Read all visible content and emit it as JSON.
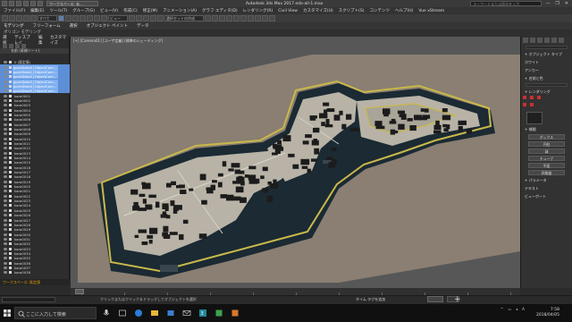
{
  "window": {
    "title": "Autodesk 3ds Max 2017     edo-all-1.max",
    "workspace": "ワークスペース: 未…",
    "search_placeholder": "キーワードまたは語句を入力",
    "controls": [
      "—",
      "❐",
      "✕"
    ]
  },
  "menubar": [
    "ファイル(F)",
    "編集(E)",
    "ツール(T)",
    "グループ(G)",
    "ビュー(V)",
    "作成(C)",
    "修正(M)",
    "アニメーション(A)",
    "グラフ エディタ(D)",
    "レンダリング(R)",
    "Civil View",
    "カスタマイズ(U)",
    "スクリプト(S)",
    "コンテンツ",
    "ヘルプ(H)",
    "Vue xStream"
  ],
  "toolbar": {
    "selection_filter": "すべて",
    "view_dropdown": "ビュー",
    "selection_set": "選択セットの作成"
  },
  "ribbon": {
    "tabs": [
      "モデリング",
      "フリーフォーム",
      "選択",
      "オブジェクト ペイント",
      "データ"
    ],
    "sub_label": "ポリゴン モデリング"
  },
  "explorer": {
    "tabs": [
      "選択",
      "ディスプレイ",
      "編集",
      "カスタマイズ"
    ],
    "column_header": "名前 (昇順ソート)",
    "root": "0 (既定値)",
    "selected_items": [
      "goreiData0 [ObjectCom…",
      "goreiData1 [ObjectCom…",
      "goreiData2 [ObjectCom…",
      "goreiData3 [ObjectCom…",
      "goreiData4 [ObjectCom…",
      "goreiData5 [ObjectCom…"
    ],
    "items": [
      "kara0001",
      "kara0002",
      "kara0003",
      "kara0004",
      "kara0005",
      "kara0006",
      "kara0007",
      "kara0008",
      "kara0009",
      "kara0010",
      "kara0011",
      "kara0012",
      "kara0013",
      "kara0014",
      "kara0015",
      "kara0016",
      "kara0017",
      "kara0018",
      "kara0019",
      "kara0020",
      "kara0021",
      "kara0022",
      "kara0023",
      "kara0024",
      "kara0025",
      "kara0026",
      "kara0027",
      "kara0028",
      "kara0029",
      "kara0030",
      "kara0031",
      "kara0032",
      "kara0033",
      "kara0034",
      "kara0035",
      "kara0036",
      "kara0037",
      "kara0038"
    ],
    "layer_bar": "ワークスペース: 既定値"
  },
  "viewport": {
    "label": "[+] [Camera01] [ユーザ定義] [標準のシェーディング]"
  },
  "command_panel": {
    "sections": [
      "+ オブジェクト タイプ",
      "+ 名前と色",
      "+ レンダリング",
      "+ 補間",
      "+ パラメータ"
    ],
    "buttons": [
      "ボックス",
      "円柱",
      "球",
      "チューブ",
      "平面",
      "四角錐"
    ],
    "labels": [
      "ホワイト",
      "アンカー",
      "テキスト",
      "ビューポート"
    ]
  },
  "timeline": {
    "position": "0 / 100",
    "ticks": [
      "0",
      "10",
      "20",
      "30",
      "40",
      "50",
      "60",
      "70",
      "80",
      "90",
      "100"
    ]
  },
  "statusbar": {
    "message": "クリックまたはクリック＆ドラッグしてオブジェクトを選択",
    "add_time_tag": "タイム タグを追加",
    "key_mode": "オートキー"
  },
  "taskbar": {
    "search_placeholder": "ここに入力して検索",
    "clock_time": "7:58",
    "clock_date": "2018/04/05"
  },
  "colors": {
    "ground": "#8a7f72",
    "water": "#1b2a33",
    "wall": "#c9b84a",
    "block": "#b8b3a6",
    "roof": "#1c1c1c",
    "selection": "#5d8fd8"
  }
}
